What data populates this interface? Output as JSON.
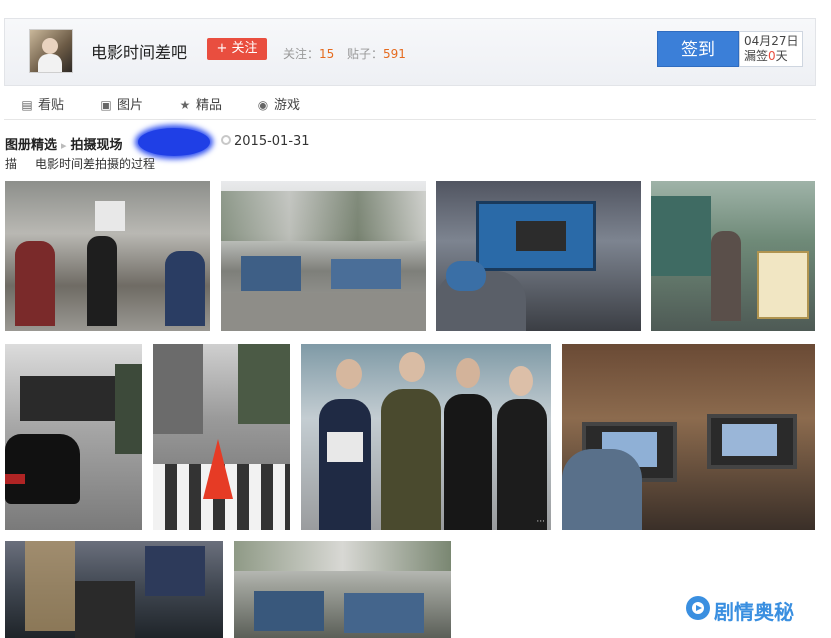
{
  "header": {
    "forum_name": "电影时间差吧",
    "follow_label": "+ 关注",
    "followers_label": "关注：",
    "followers_count": "15",
    "posts_label": "贴子：",
    "posts_count": "591",
    "sign_label": "签到",
    "sign_date": "04月27日",
    "missed_prefix": "漏签",
    "missed_count": "0",
    "missed_suffix": "天"
  },
  "tabs": [
    {
      "label": "看贴",
      "icon": "document-icon"
    },
    {
      "label": "图片",
      "icon": "image-icon"
    },
    {
      "label": "精品",
      "icon": "star-icon"
    },
    {
      "label": "游戏",
      "icon": "gamepad-icon"
    }
  ],
  "breadcrumb": {
    "album": "图册精选",
    "category": "拍摄现场",
    "date": "2015-01-31"
  },
  "description": {
    "label": "描",
    "text": "电影时间差拍摄的过程"
  },
  "watermark": "剧情奥秘",
  "colors": {
    "accent": "#3b7fd8",
    "follow": "#e94e3f",
    "count": "#e56b1f",
    "logo": "#3a8fe0"
  }
}
